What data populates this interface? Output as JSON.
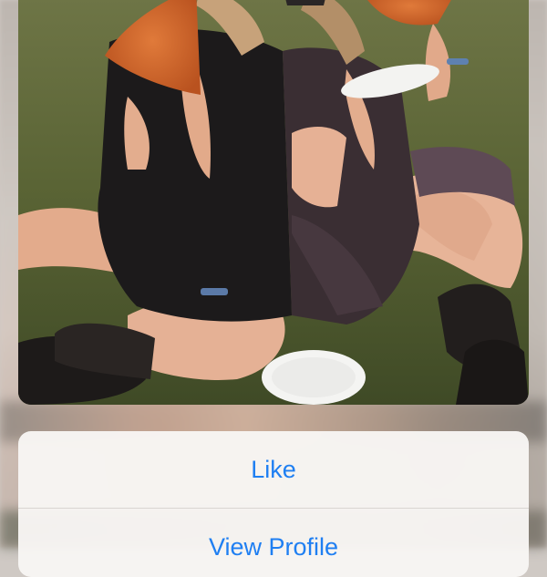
{
  "action_sheet": {
    "items": [
      {
        "label": "Like"
      },
      {
        "label": "View Profile"
      }
    ]
  },
  "colors": {
    "action_text": "#1f7ff2",
    "sheet_background": "#f8f6f4",
    "divider": "#d9d5d1"
  }
}
